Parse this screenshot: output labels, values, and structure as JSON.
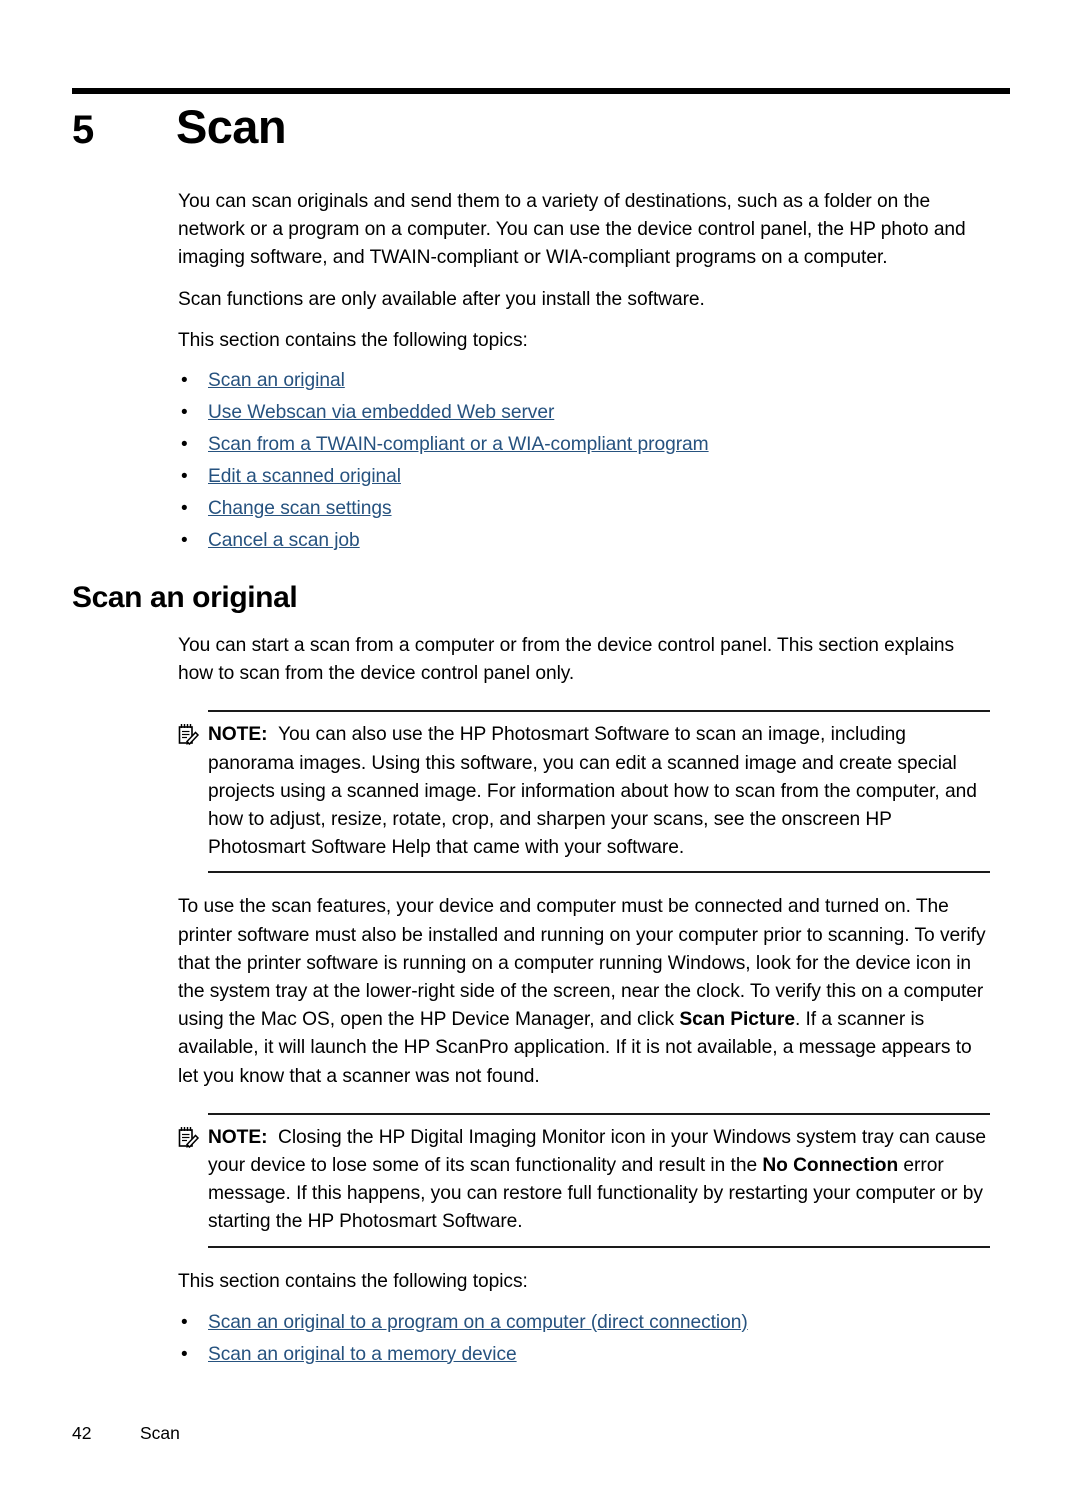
{
  "chapter": {
    "number": "5",
    "title": "Scan"
  },
  "intro": {
    "paragraph1": "You can scan originals and send them to a variety of destinations, such as a folder on the network or a program on a computer. You can use the device control panel, the HP photo and imaging software, and TWAIN-compliant or WIA-compliant programs on a computer.",
    "paragraph2": "Scan functions are only available after you install the software.",
    "paragraph3": "This section contains the following topics:"
  },
  "topic_links": [
    {
      "label": "Scan an original"
    },
    {
      "label": "Use Webscan via embedded Web server"
    },
    {
      "label": "Scan from a TWAIN-compliant or a WIA-compliant program"
    },
    {
      "label": "Edit a scanned original"
    },
    {
      "label": "Change scan settings"
    },
    {
      "label": "Cancel a scan job"
    }
  ],
  "section": {
    "heading": "Scan an original",
    "paragraph1": "You can start a scan from a computer or from the device control panel. This section explains how to scan from the device control panel only.",
    "paragraph2_part1": "To use the scan features, your device and computer must be connected and turned on. The printer software must also be installed and running on your computer prior to scanning. To verify that the printer software is running on a computer running Windows, look for the device icon in the system tray at the lower-right side of the screen, near the clock. To verify this on a computer using the Mac OS, open the HP Device Manager, and click ",
    "paragraph2_bold": "Scan Picture",
    "paragraph2_part2": ". If a scanner is available, it will launch the HP ScanPro application. If it is not available, a message appears to let you know that a scanner was not found.",
    "paragraph3": "This section contains the following topics:"
  },
  "notes": [
    {
      "label": "NOTE:",
      "icon": "note-pencil-icon",
      "text": "You can also use the HP Photosmart Software to scan an image, including panorama images. Using this software, you can edit a scanned image and create special projects using a scanned image. For information about how to scan from the computer, and how to adjust, resize, rotate, crop, and sharpen your scans, see the onscreen HP Photosmart Software Help that came with your software."
    },
    {
      "label": "NOTE:",
      "icon": "note-pencil-icon",
      "text_part1": "Closing the HP Digital Imaging Monitor icon in your Windows system tray can cause your device to lose some of its scan functionality and result in the ",
      "text_bold": "No Connection",
      "text_part2": " error message. If this happens, you can restore full functionality by restarting your computer or by starting the HP Photosmart Software."
    }
  ],
  "section_links": [
    {
      "label": "Scan an original to a program on a computer (direct connection)"
    },
    {
      "label": "Scan an original to a memory device"
    }
  ],
  "footer": {
    "page_number": "42",
    "title": "Scan"
  },
  "bullet_glyph": "•",
  "colors": {
    "link": "#26527f",
    "text": "#000000",
    "rule": "#000000"
  }
}
